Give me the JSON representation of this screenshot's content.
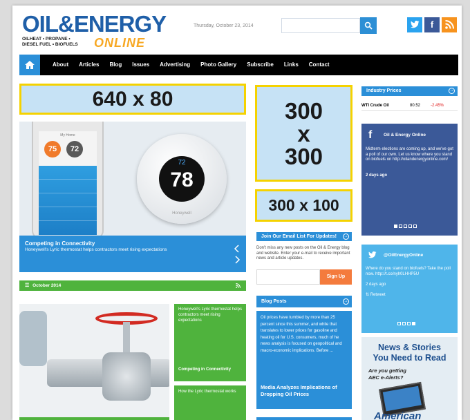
{
  "header": {
    "logo_main": "OIL&ENERGY",
    "logo_online": "ONLINE",
    "logo_tagline_1": "OILHEAT • PROPANE •",
    "logo_tagline_2": "DIESEL FUEL • BIOFUELS",
    "date": "Thursday, October 23, 2014",
    "search_placeholder": "",
    "search_icon": "search-icon",
    "social": {
      "twitter": "t",
      "facebook": "f",
      "rss": "rss"
    }
  },
  "nav": {
    "home_icon": "home-icon",
    "items": [
      "About",
      "Articles",
      "Blog",
      "Issues",
      "Advertising",
      "Photo Gallery",
      "Subscribe",
      "Links",
      "Contact"
    ]
  },
  "ads": {
    "leaderboard": "640 x 80",
    "square_line1": "300",
    "square_line2": "x",
    "square_line3": "300",
    "banner": "300 x 100"
  },
  "hero": {
    "title": "Competing in Connectivity",
    "subtitle": "Honeywell's Lyric thermostat helps contractors meet rising expectations",
    "phone_title": "My Home",
    "temp1": "75",
    "temp2": "72",
    "thermo_set": "72",
    "thermo_temp": "78",
    "brand": "Honeywell"
  },
  "month_bar": {
    "label": "October 2014"
  },
  "stories": {
    "card1_text": "Honeywell's Lyric thermostat helps contractors meet rising expectations",
    "card1_title": "Competing in Connectivity",
    "card2_text": "How the Lyric thermostat works"
  },
  "email": {
    "header": "Join Our Email List For Updates!",
    "text": "Don't miss any new posts on the Oil & Energy blog and website. Enter your e-mail to receive important news and article updates.",
    "signup": "Sign Up"
  },
  "blog": {
    "header": "Blog Posts",
    "excerpt": "Oil prices have tumbled by more than 25 percent since this summer, and while that translates to lower prices for gasoline and heating oil for U.S. consumers, much of he news analysis is focused on geopolitical and macro-economic implications. Before ...",
    "title": "Media Analyzes Implications of Dropping Oil Prices"
  },
  "industry": {
    "header": "Industry Prices",
    "name": "WTI Crude Oil",
    "price": "80.52",
    "change": "-2.45%",
    "change_color": "#e02020"
  },
  "facebook": {
    "name": "Oil & Energy Online",
    "post": "Midterm elections are coming up, and we've got a poll of our own. Let us know where you stand on biofuels on http://oilandenergyonline.com/",
    "time": "2 days ago"
  },
  "twitter": {
    "handle": "@OilEnergyOnline",
    "post": "Where do you stand on biofuels? Take the poll now. http://t.co/nyh0LHHP5U",
    "time": "2 days ago",
    "retweet": "Retweet"
  },
  "news": {
    "title_1": "News & Stories",
    "title_2": "You Need to Read",
    "question_1": "Are you getting",
    "question_2": "AEC e-Alerts?",
    "brand": "American"
  },
  "colors": {
    "brand_blue": "#2b8fd8",
    "brand_green": "#4fb33d",
    "logo_orange": "#f7a823"
  }
}
